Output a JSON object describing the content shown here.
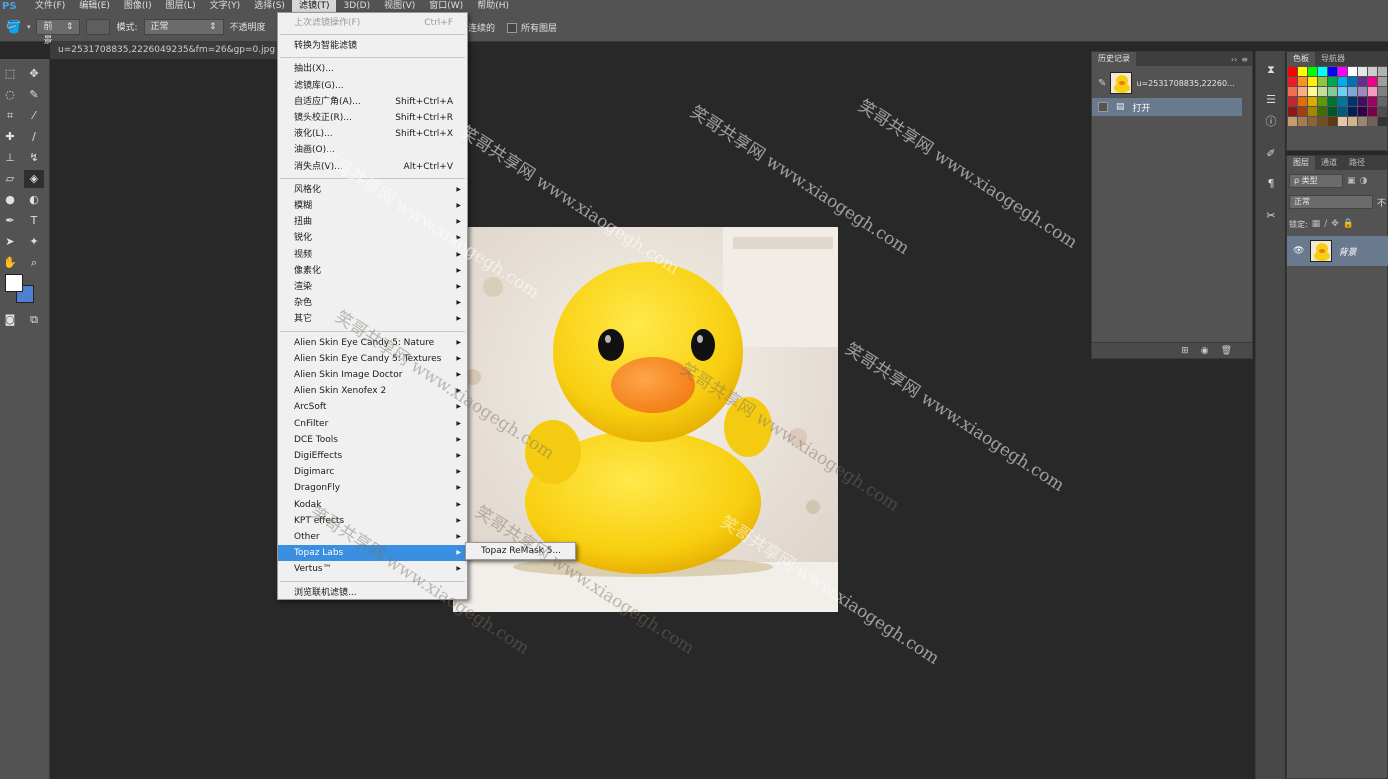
{
  "app": {
    "logo": "PS"
  },
  "menubar": {
    "items": [
      "文件(F)",
      "编辑(E)",
      "图像(I)",
      "图层(L)",
      "文字(Y)",
      "选择(S)",
      "滤镜(T)",
      "3D(D)",
      "视图(V)",
      "窗口(W)",
      "帮助(H)"
    ],
    "active": "滤镜(T)"
  },
  "options": {
    "preset_value": "前景",
    "mode_label": "模式:",
    "mode_value": "正常",
    "opacity_label": "不透明度",
    "contiguous_label": "连续的",
    "all_layers_label": "所有图层"
  },
  "document": {
    "tab_title": "u=2531708835,2226049235&fm=26&gp=0.jpg @"
  },
  "filter_menu": {
    "last_filter": {
      "label": "上次滤镜操作(F)",
      "shortcut": "Ctrl+F"
    },
    "smart_filter": "转换为智能滤镜",
    "group1": [
      {
        "label": "抽出(X)...",
        "shortcut": ""
      },
      {
        "label": "滤镜库(G)...",
        "shortcut": ""
      },
      {
        "label": "自适应广角(A)...",
        "shortcut": "Shift+Ctrl+A"
      },
      {
        "label": "镜头校正(R)...",
        "shortcut": "Shift+Ctrl+R"
      },
      {
        "label": "液化(L)...",
        "shortcut": "Shift+Ctrl+X"
      },
      {
        "label": "油画(O)...",
        "shortcut": ""
      },
      {
        "label": "消失点(V)...",
        "shortcut": "Alt+Ctrl+V"
      }
    ],
    "group2": [
      "风格化",
      "模糊",
      "扭曲",
      "锐化",
      "视频",
      "像素化",
      "渲染",
      "杂色",
      "其它"
    ],
    "group3": [
      "Alien Skin Eye Candy 5: Nature",
      "Alien Skin Eye Candy 5: Textures",
      "Alien Skin Image Doctor",
      "Alien Skin Xenofex 2",
      "ArcSoft",
      "CnFilter",
      "DCE Tools",
      "DigiEffects",
      "Digimarc",
      "DragonFly",
      "Kodak",
      "KPT effects",
      "Other",
      "Topaz Labs",
      "Vertus™"
    ],
    "highlighted": "Topaz Labs",
    "browse_online": "浏览联机滤镜...",
    "submenu": [
      "Topaz ReMask 5..."
    ]
  },
  "history_panel": {
    "tabs": [
      "历史记录"
    ],
    "snapshot_name": "u=2531708835,22260...",
    "states": [
      "打开"
    ]
  },
  "swatches_panel": {
    "tabs": [
      "色板",
      "导航器"
    ],
    "colors": [
      "#ff0000",
      "#ffff00",
      "#00ff00",
      "#00ffff",
      "#0000ff",
      "#ff00ff",
      "#ffffff",
      "#e6e6e6",
      "#cccccc",
      "#b3b3b3",
      "#ed1c24",
      "#f7941d",
      "#fff200",
      "#8dc63f",
      "#00a651",
      "#00aeef",
      "#0072bc",
      "#662d91",
      "#ec008c",
      "#9e9e9e",
      "#f26c4f",
      "#f9ad81",
      "#fff799",
      "#c4df9b",
      "#82ca9c",
      "#6dcff6",
      "#7da7d9",
      "#a187be",
      "#f49ac1",
      "#808080",
      "#c1272d",
      "#e36c09",
      "#d5ae00",
      "#5a9a08",
      "#007236",
      "#0076a3",
      "#003471",
      "#440e62",
      "#9e005d",
      "#666666",
      "#8c1a1a",
      "#a0410d",
      "#a38800",
      "#3f6f06",
      "#005826",
      "#005b7f",
      "#002157",
      "#32004b",
      "#7b0046",
      "#4d4d4d",
      "#c69c6d",
      "#a67c52",
      "#8c6239",
      "#754c24",
      "#603913",
      "#e2c9a4",
      "#d0b48c",
      "#998675",
      "#736357",
      "#333333"
    ]
  },
  "layers_panel": {
    "tabs": [
      "图层",
      "通道",
      "路径"
    ],
    "filter_label": "ρ 类型",
    "blend_mode": "正常",
    "opacity_short": "不",
    "lock_label": "锁定:",
    "layers": [
      {
        "name": "背景"
      }
    ]
  },
  "watermark": {
    "text": "笑哥共享网 www.xiaogegh.com"
  }
}
